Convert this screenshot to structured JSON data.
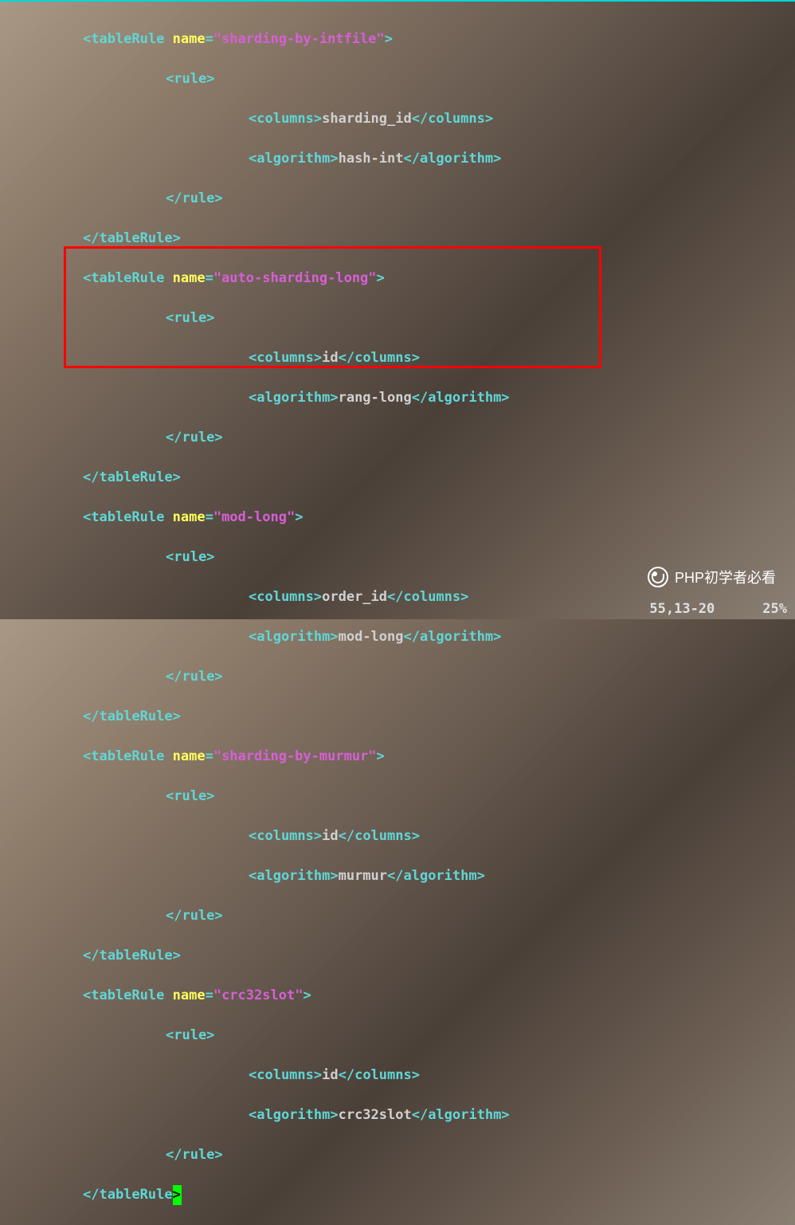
{
  "rules": [
    {
      "name": "sharding-by-intfile",
      "column": "sharding_id",
      "algorithm": "hash-int",
      "highlighted": false
    },
    {
      "name": "auto-sharding-long",
      "column": "id",
      "algorithm": "rang-long",
      "highlighted": false
    },
    {
      "name": "mod-long",
      "column": "order_id",
      "algorithm": "mod-long",
      "highlighted": true
    },
    {
      "name": "sharding-by-murmur",
      "column": "id",
      "algorithm": "murmur",
      "highlighted": false
    },
    {
      "name": "crc32slot",
      "column": "id",
      "algorithm": "crc32slot",
      "highlighted": false
    }
  ],
  "tags": {
    "tableRule_open": "<tableRule",
    "tableRule_close": "</tableRule>",
    "rule_open": "<rule>",
    "rule_close": "</rule>",
    "columns_open": "<columns>",
    "columns_close": "</columns>",
    "algorithm_open": "<algorithm>",
    "algorithm_close": "</algorithm>",
    "name_attr": "name",
    "gt": ">"
  },
  "status": {
    "position": "55,13-20",
    "percent": "25%"
  },
  "watermark": {
    "text": "PHP初学者必看"
  }
}
